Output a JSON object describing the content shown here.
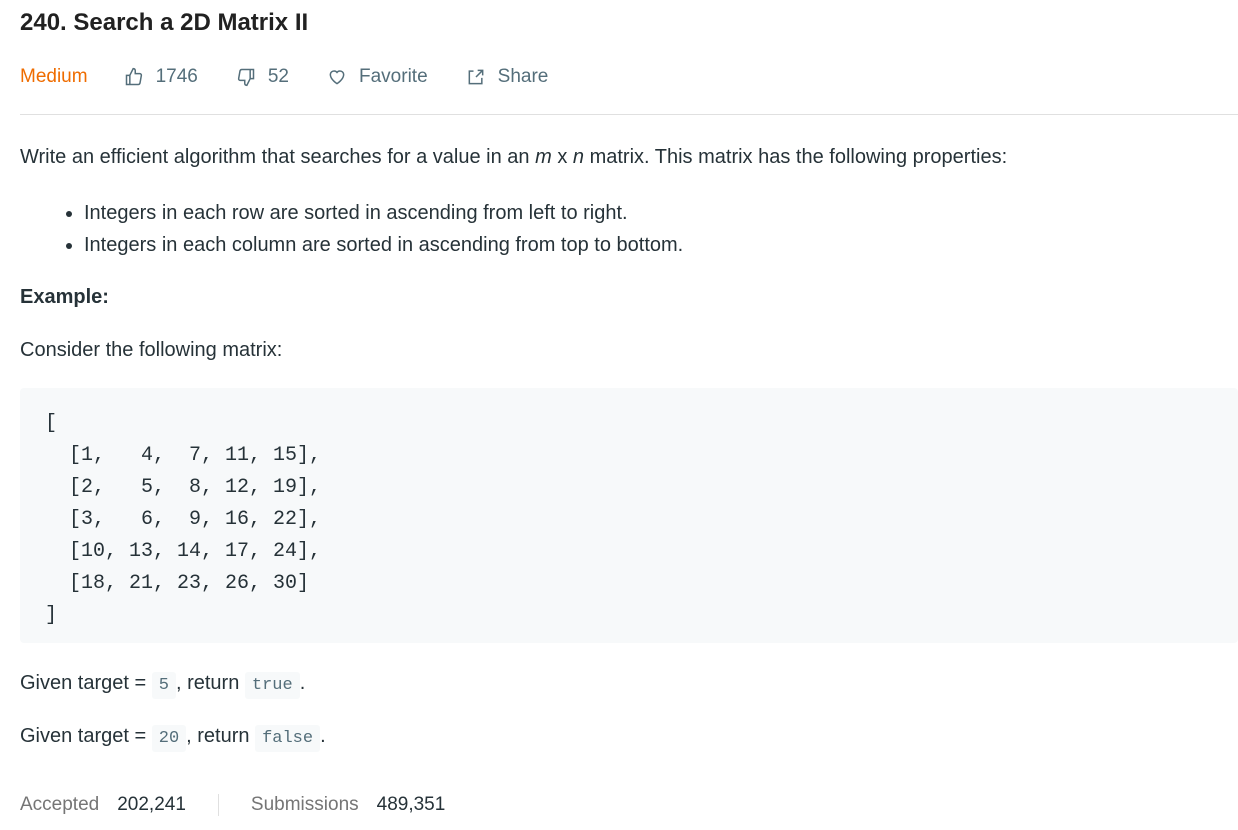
{
  "title": "240. Search a 2D Matrix II",
  "meta": {
    "difficulty": "Medium",
    "likes": "1746",
    "dislikes": "52",
    "favorite": "Favorite",
    "share": "Share",
    "difficulty_color": "#ef6c00"
  },
  "description": {
    "intro_pre": "Write an efficient algorithm that searches for a value in an ",
    "m": "m",
    "x": " x ",
    "n": "n",
    "intro_post": " matrix. This matrix has the following properties:",
    "bullets": [
      "Integers in each row are sorted in ascending from left to right.",
      "Integers in each column are sorted in ascending from top to bottom."
    ],
    "example_heading": "Example:",
    "consider": "Consider the following matrix:",
    "code": "[\n  [1,   4,  7, 11, 15],\n  [2,   5,  8, 12, 19],\n  [3,   6,  9, 16, 22],\n  [10, 13, 14, 17, 24],\n  [18, 21, 23, 26, 30]\n]",
    "given1": {
      "pre": "Given target = ",
      "target": "5",
      "mid": ", return ",
      "result": "true",
      "end": "."
    },
    "given2": {
      "pre": "Given target = ",
      "target": "20",
      "mid": ", return ",
      "result": "false",
      "end": "."
    }
  },
  "stats": {
    "accepted_label": "Accepted",
    "accepted": "202,241",
    "submissions_label": "Submissions",
    "submissions": "489,351"
  }
}
